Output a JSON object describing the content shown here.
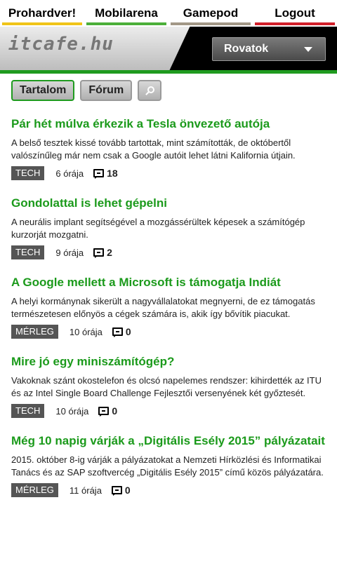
{
  "topnav": [
    {
      "label": "Prohardver!",
      "color": "#f0c419"
    },
    {
      "label": "Mobilarena",
      "color": "#4caf3a"
    },
    {
      "label": "Gamepod",
      "color": "#a39887"
    },
    {
      "label": "Logout",
      "color": "#d1202a"
    }
  ],
  "header": {
    "logo": "itcafe.hu",
    "menu_label": "Rovatok"
  },
  "tabs": {
    "content": "Tartalom",
    "forum": "Fórum"
  },
  "articles": [
    {
      "title": "Pár hét múlva érkezik a Tesla önvezető autója",
      "lead": "A belső tesztek kissé tovább tartottak, mint számították, de októbertől valószínűleg már nem csak a Google autóit lehet látni Kalifornia útjain.",
      "tag": "TECH",
      "time": "6 órája",
      "comments": "18"
    },
    {
      "title": "Gondolattal is lehet gépelni",
      "lead": "A neurális implant segítségével a mozgássérültek képesek a számítógép kurzorját mozgatni.",
      "tag": "TECH",
      "time": "9 órája",
      "comments": "2"
    },
    {
      "title": "A Google mellett a Microsoft is támogatja Indiát",
      "lead": "A helyi kormánynak sikerült a nagyvállalatokat megnyerni, de ez támogatás természetesen előnyös a cégek számára is, akik így bővítik piacukat.",
      "tag": "MÉRLEG",
      "time": "10 órája",
      "comments": "0"
    },
    {
      "title": "Mire jó egy miniszámítógép?",
      "lead": "Vakoknak szánt okostelefon és olcsó napelemes rendszer: kihirdették az ITU és az Intel Single Board Challenge Fejlesztői versenyének két győztesét.",
      "tag": "TECH",
      "time": "10 órája",
      "comments": "0"
    },
    {
      "title": "Még 10 napig várják a „Digitális Esély 2015” pályázatait",
      "lead": "2015. október 8-ig várják a pályázatokat a Nemzeti Hírközlési és Informatikai Tanács és az SAP szoftvercég „Digitális Esély 2015” című közös pályázatára.",
      "tag": "MÉRLEG",
      "time": "11 órája",
      "comments": "0"
    }
  ]
}
